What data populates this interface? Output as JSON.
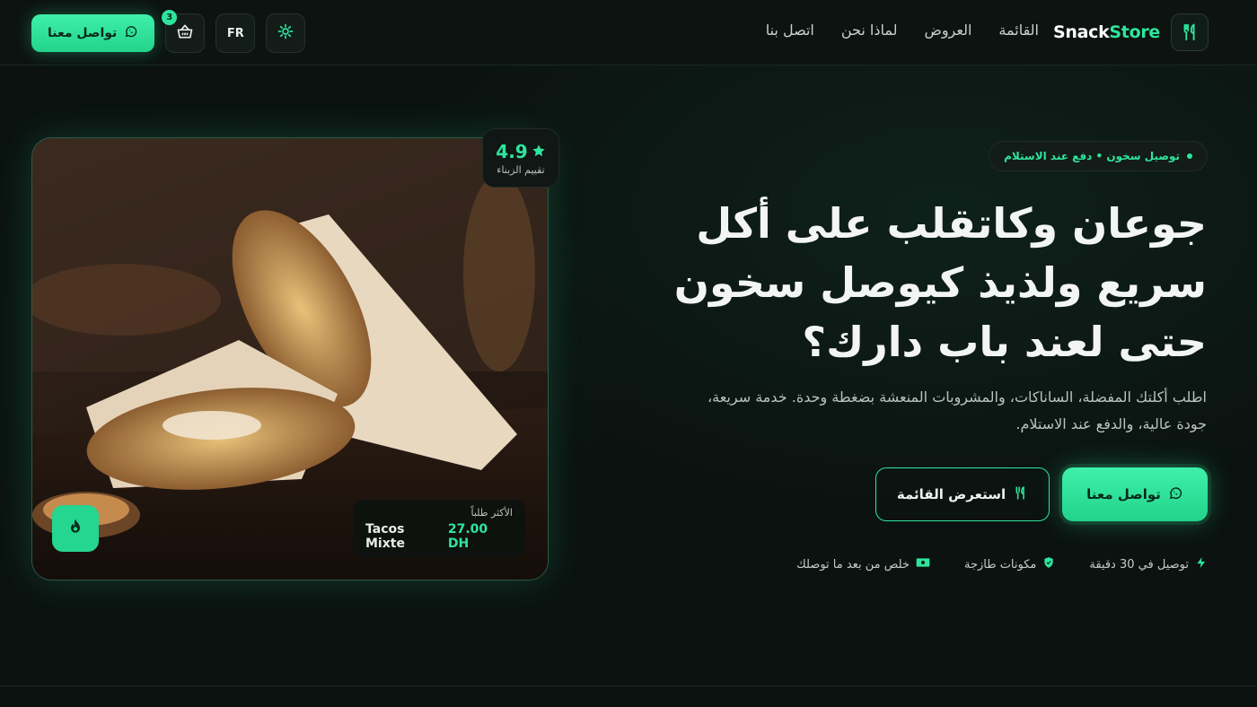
{
  "brand": {
    "name_part1": "Snack",
    "name_part2": "Store",
    "logo_icon": "fork-knife-icon"
  },
  "nav": {
    "items": [
      "القائمة",
      "العروض",
      "لماذا نحن",
      "اتصل بنا"
    ]
  },
  "header_actions": {
    "whatsapp_label": "تواصل معنا",
    "cart_count": "3",
    "lang_label": "FR",
    "theme_icon": "sun-icon"
  },
  "hero": {
    "pill_text": "توصيل سخون • دفع عند الاستلام",
    "title": "جوعان وكاتقلب على أكل سريع ولذيذ كيوصل سخون حتى لعند باب دارك؟",
    "description": "اطلب أكلتك المفضلة، الساناكات، والمشروبات المنعشة بضغطة وحدة. خدمة سريعة، جودة عالية، والدفع عند الاستلام.",
    "cta_primary": "تواصل معنا",
    "cta_secondary": "استعرض القائمة",
    "features": [
      "توصيل في 30 دقيقة",
      "مكونات طازجة",
      "خلص من بعد ما توصلك"
    ]
  },
  "image_card": {
    "rating_value": "4.9",
    "rating_label": "تقييم الزبناء",
    "best_label": "الأكثر طلباً",
    "best_item": "Tacos Mixte",
    "best_price": "27.00 DH"
  },
  "colors": {
    "accent": "#2ee59d",
    "background": "#0b1210"
  }
}
